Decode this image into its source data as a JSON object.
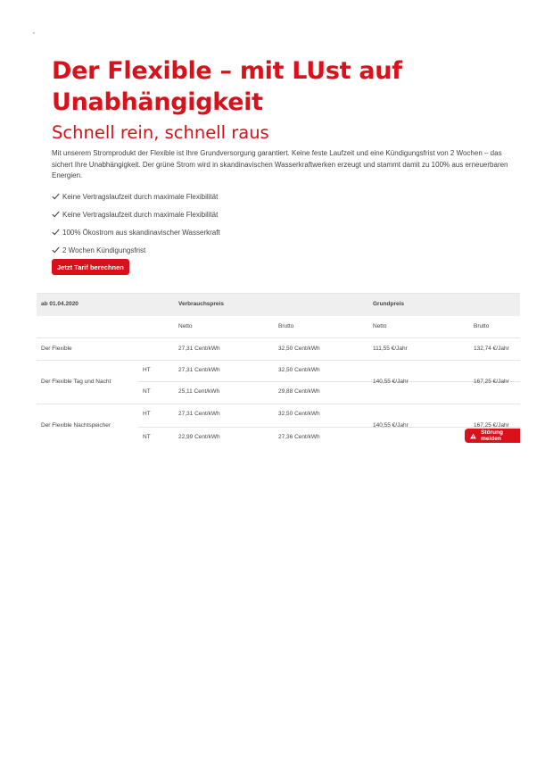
{
  "hero": {
    "title": "Der Flexible – mit LUst auf Unabhängigkeit",
    "subtitle": "Schnell rein, schnell raus",
    "intro": "Mit unserem Stromprodukt der Flexible ist Ihre Grundversorgung garantiert. Keine feste Laufzeit und eine Kündigungsfrist von 2 Wochen – das sichert Ihre Unabhängigkeit. Der grüne Strom wird in skandinavischen Wasserkraftwerken erzeugt und stammt damit zu 100% aus erneuerbaren Energien.",
    "features": [
      "Keine Vertragslaufzeit durch maximale Flexibilität",
      "Keine Vertragslaufzeit durch maximale Flexibilität",
      "100% Ökostrom aus skandinavischer Wasserkraft",
      "2 Wochen Kündigungsfrist"
    ],
    "cta_label": "Jetzt Tarif berechnen"
  },
  "table": {
    "date_header": "ab 01.04.2020",
    "verbrauch_header": "Verbrauchspreis",
    "grund_header": "Grundpreis",
    "netto": "Netto",
    "brutto": "Brutto",
    "rows": [
      {
        "name": "Der Flexible",
        "ht": "",
        "v_netto": "27,31 Cent/kWh",
        "v_brutto": "32,50 Cent/kWh",
        "g_netto": "111,55 €/Jahr",
        "g_brutto": "132,74 €/Jahr"
      },
      {
        "name": "Der Flexible Tag und Nacht",
        "g_netto": "140,55 €/Jahr",
        "g_brutto": "167,25 €/Jahr",
        "sub": [
          {
            "tariff": "HT",
            "v_netto": "27,31 Cent/kWh",
            "v_brutto": "32,50 Cent/kWh"
          },
          {
            "tariff": "NT",
            "v_netto": "25,11 Cent/kWh",
            "v_brutto": "29,88 Cent/kWh"
          }
        ]
      },
      {
        "name": "Der Flexible Nachtspeicher",
        "g_netto": "140,55 €/Jahr",
        "g_brutto": "167,25 €/Jahr",
        "sub": [
          {
            "tariff": "HT",
            "v_netto": "27,31 Cent/kWh",
            "v_brutto": "32,50 Cent/kWh"
          },
          {
            "tariff": "NT",
            "v_netto": "22,99 Cent/kWh",
            "v_brutto": "27,36 Cent/kWh"
          }
        ]
      }
    ]
  },
  "report_button": {
    "label": "Störung melden",
    "icon": "warning-icon"
  },
  "colors": {
    "brand": "#d8111b"
  }
}
